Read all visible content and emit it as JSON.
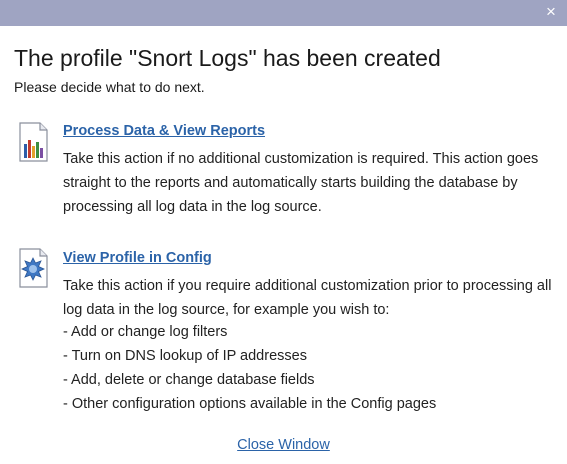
{
  "titlebar": {
    "close_glyph": "×"
  },
  "heading": "The profile \"Snort Logs\" has been created",
  "subheading": "Please decide what to do next.",
  "options": [
    {
      "icon": "bar-chart-report-icon",
      "link": "Process Data & View Reports",
      "description": "Take this action if no additional customization is required. This action goes straight to the reports and automatically starts building the database by processing all log data in the log source."
    },
    {
      "icon": "gear-config-icon",
      "link": "View Profile in Config",
      "description": "Take this action if you require additional customization prior to processing all log data in the log source, for example you wish to:",
      "bullets": [
        "- Add or change log filters",
        "- Turn on DNS lookup of IP addresses",
        "- Add, delete or change database fields",
        "- Other configuration options available in the Config pages"
      ]
    }
  ],
  "close_window_label": "Close Window",
  "colors": {
    "titlebar": "#9fa4c2",
    "link": "#2b63a8",
    "text": "#222222"
  }
}
